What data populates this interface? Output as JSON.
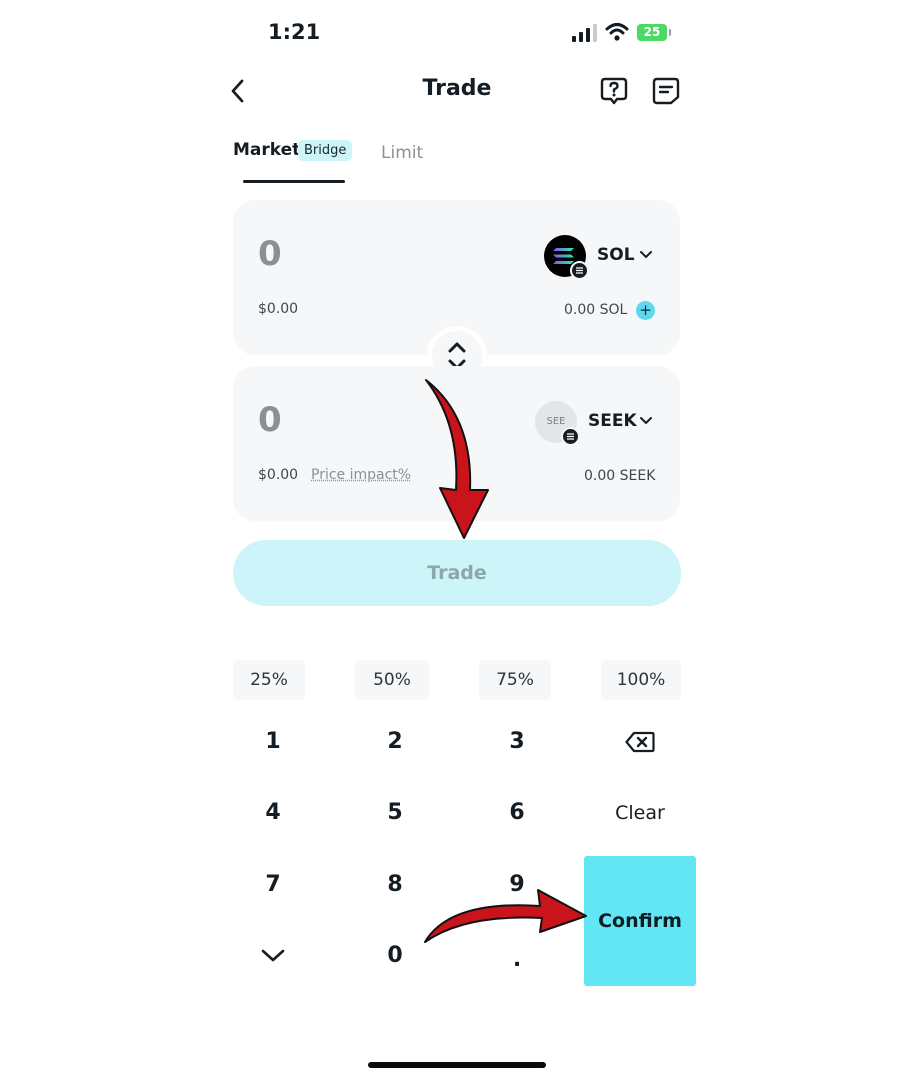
{
  "status_bar": {
    "time": "1:21",
    "battery": "25"
  },
  "header": {
    "title": "Trade"
  },
  "tabs": {
    "market": "Market",
    "badge": "Bridge",
    "limit": "Limit"
  },
  "from_card": {
    "amount": "0",
    "usd": "$0.00",
    "token": "SOL",
    "balance": "0.00 SOL",
    "add": "+"
  },
  "to_card": {
    "amount": "0",
    "usd": "$0.00",
    "price_impact": "Price impact%",
    "token": "SEEK",
    "token_logo": "SEE",
    "balance": "0.00 SEEK"
  },
  "trade_button": "Trade",
  "percents": [
    "25%",
    "50%",
    "75%",
    "100%"
  ],
  "keypad": {
    "k1": "1",
    "k2": "2",
    "k3": "3",
    "k4": "4",
    "k5": "5",
    "k6": "6",
    "clear": "Clear",
    "k7": "7",
    "k8": "8",
    "k9": "9",
    "k0": "0",
    "dot": "."
  },
  "confirm": "Confirm",
  "colors": {
    "accent": "#62e6f4",
    "trade_disabled": "#cdf4f8",
    "arrow": "#c8141a"
  }
}
